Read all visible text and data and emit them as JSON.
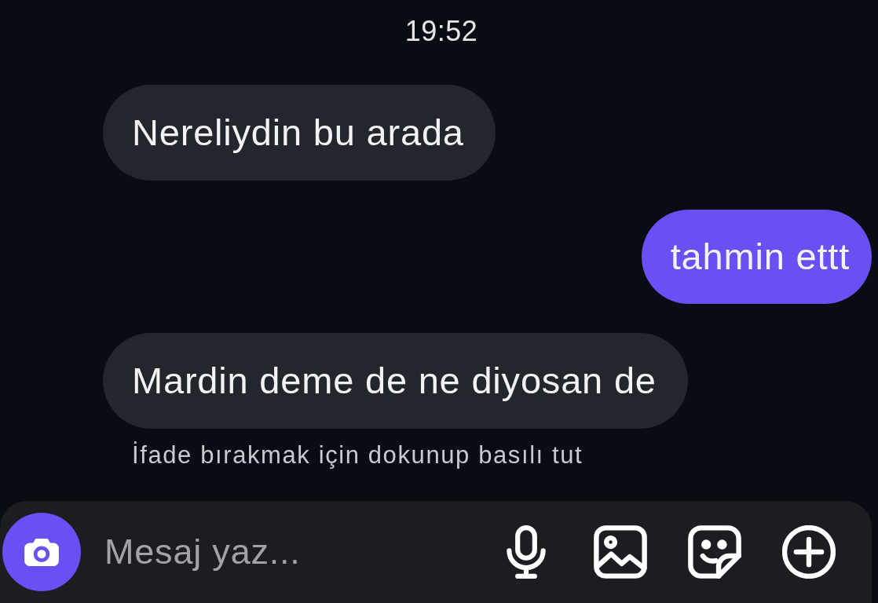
{
  "timestamp": "19:52",
  "messages": [
    {
      "kind": "received",
      "text": "Nereliydin bu arada"
    },
    {
      "kind": "sent",
      "text": "tahmin ettt"
    },
    {
      "kind": "received",
      "text": "Mardin deme de ne diyosan de"
    }
  ],
  "reaction_hint": "İfade bırakmak için dokunup basılı tut",
  "composer": {
    "placeholder": "Mesaj yaz..."
  }
}
